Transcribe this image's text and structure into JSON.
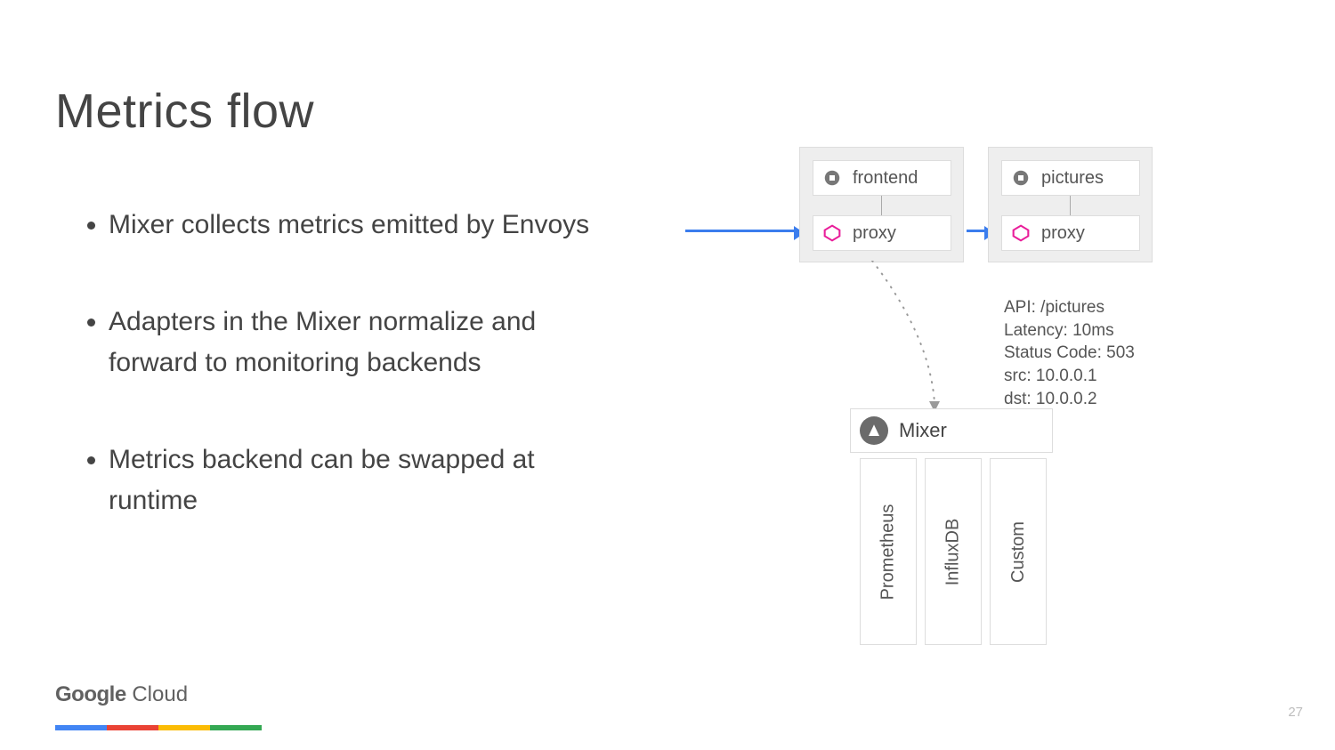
{
  "title": "Metrics flow",
  "bullets": [
    "Mixer collects metrics emitted by Envoys",
    "Adapters in the Mixer normalize and forward to monitoring backends",
    "Metrics backend can be swapped at runtime"
  ],
  "diagram": {
    "pods": [
      {
        "name": "frontend",
        "proxy": "proxy"
      },
      {
        "name": "pictures",
        "proxy": "proxy"
      }
    ],
    "metrics_lines": [
      "API: /pictures",
      "Latency: 10ms",
      "Status Code: 503",
      "src: 10.0.0.1",
      "dst: 10.0.0.2"
    ],
    "mixer_label": "Mixer",
    "adapters": [
      "Prometheus",
      "InfluxDB",
      "Custom"
    ]
  },
  "footer": {
    "logo_bold": "Google",
    "logo_rest": " Cloud",
    "page": "27"
  }
}
